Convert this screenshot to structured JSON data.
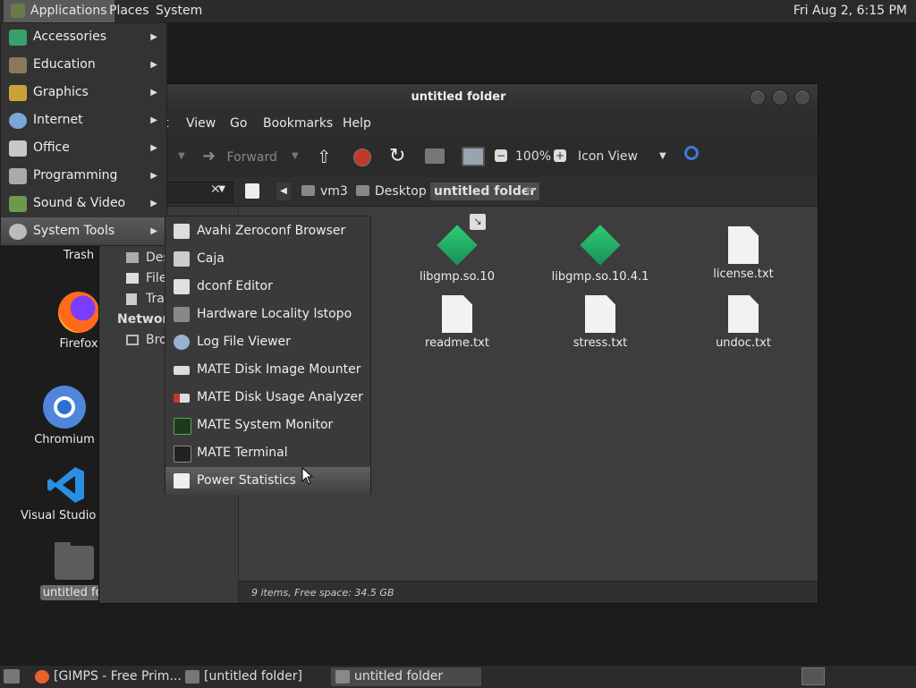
{
  "top_panel": {
    "apps": "Applications",
    "places": "Places",
    "system": "System",
    "clock": "Fri Aug  2,  6:15 PM"
  },
  "desktop": {
    "icons": [
      {
        "label": "Trash",
        "icon": "trash-icon"
      },
      {
        "label": "Firefox",
        "icon": "firefox-icon"
      },
      {
        "label": "Chromium",
        "icon": "chromium-icon"
      },
      {
        "label": "Visual Studio Co",
        "icon": "vscode-icon"
      },
      {
        "label": "untitled fol",
        "icon": "folder-icon"
      }
    ]
  },
  "window": {
    "title": "untitled folder",
    "menu": [
      "t",
      "View",
      "Go",
      "Bookmarks",
      "Help"
    ],
    "toolbar": {
      "forward": "Forward",
      "zoom": "100%",
      "view_mode": "Icon View"
    },
    "breadcrumbs": [
      "vm3",
      "Desktop",
      "untitled folder"
    ],
    "sidebar": {
      "items": [
        "Des",
        "File",
        "Tra"
      ],
      "network_header": "Network",
      "network_items": [
        "Bro"
      ]
    },
    "files": [
      {
        "name": "libgmp.so.10",
        "type": "library"
      },
      {
        "name": "libgmp.so.10.4.1",
        "type": "library"
      },
      {
        "name": "license.txt",
        "type": "text"
      },
      {
        "name": "readme.txt",
        "type": "text"
      },
      {
        "name": "stress.txt",
        "type": "text"
      },
      {
        "name": "undoc.txt",
        "type": "text"
      }
    ],
    "status": "9 items, Free space: 34.5 GB"
  },
  "app_menu": {
    "items": [
      {
        "label": "Accessories",
        "icon": "accessories-icon"
      },
      {
        "label": "Education",
        "icon": "education-icon"
      },
      {
        "label": "Graphics",
        "icon": "graphics-icon"
      },
      {
        "label": "Internet",
        "icon": "internet-icon"
      },
      {
        "label": "Office",
        "icon": "office-icon"
      },
      {
        "label": "Programming",
        "icon": "programming-icon"
      },
      {
        "label": "Sound & Video",
        "icon": "sound-video-icon"
      },
      {
        "label": "System Tools",
        "icon": "system-tools-icon"
      }
    ],
    "active": "System Tools"
  },
  "system_tools_menu": {
    "items": [
      {
        "label": "Avahi Zeroconf Browser",
        "icon": "avahi-icon"
      },
      {
        "label": "Caja",
        "icon": "caja-icon"
      },
      {
        "label": "dconf Editor",
        "icon": "dconf-icon"
      },
      {
        "label": "Hardware Locality lstopo",
        "icon": "hardware-icon"
      },
      {
        "label": "Log File Viewer",
        "icon": "log-viewer-icon"
      },
      {
        "label": "MATE Disk Image Mounter",
        "icon": "disk-mounter-icon"
      },
      {
        "label": "MATE Disk Usage Analyzer",
        "icon": "disk-usage-icon"
      },
      {
        "label": "MATE System Monitor",
        "icon": "system-monitor-icon"
      },
      {
        "label": "MATE Terminal",
        "icon": "terminal-icon"
      },
      {
        "label": "Power Statistics",
        "icon": "power-stats-icon"
      }
    ],
    "hovered": "Power Statistics"
  },
  "bottom_panel": {
    "tasks": [
      {
        "label": "[GIMPS - Free Prim...",
        "icon": "firefox-icon"
      },
      {
        "label": "[untitled folder]",
        "icon": "folder-icon"
      },
      {
        "label": "untitled folder",
        "icon": "folder-icon"
      }
    ]
  },
  "colors": {
    "panel_bg": "#2b2b2b",
    "desktop_bg": "#1c1c1c",
    "accent_green": "#2ecc71",
    "stop_red": "#c0392b",
    "search_blue": "#3a7bd5"
  }
}
